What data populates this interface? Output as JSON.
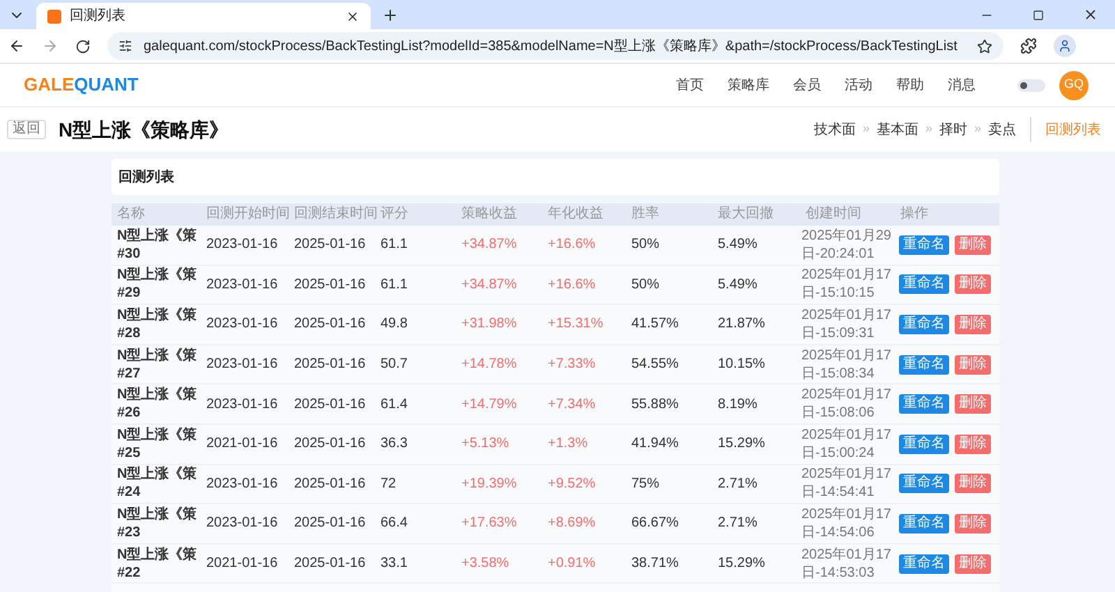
{
  "browser": {
    "tab_title": "回测列表",
    "url": "galequant.com/stockProcess/BackTestingList?modelId=385&modelName=N型上涨《策略库》&path=/stockProcess/BackTestingList"
  },
  "header": {
    "logo": [
      "GALE",
      "QUANT"
    ],
    "nav": [
      "首页",
      "策略库",
      "会员",
      "活动",
      "帮助",
      "消息"
    ],
    "theme_toggle_on": false,
    "avatar": "GQ"
  },
  "subheader": {
    "back": "返回",
    "separator": "»",
    "title": "N型上涨《策略库》",
    "steps": [
      {
        "label": "技术面",
        "selected": false
      },
      {
        "label": "基本面",
        "selected": false
      },
      {
        "label": "择时",
        "selected": false
      },
      {
        "label": "卖点",
        "selected": false
      }
    ],
    "current": {
      "label": "回测列表",
      "selected": true
    }
  },
  "card_title": "回测列表",
  "table": {
    "columns": [
      "名称",
      "回测开始时间",
      "回测结束时间",
      "评分",
      "策略收益",
      "年化收益",
      "胜率",
      "最大回撤",
      "创建时间",
      "操作"
    ],
    "rows": [
      {
        "name": "N型上涨《策",
        "number": "#30",
        "start": "2023-01-16",
        "end": "2025-01-16",
        "score": "61.1",
        "return": "+34.87%",
        "annual": "+16.6%",
        "win": "50%",
        "drawdown": "5.49%",
        "created": [
          "2025年01月29",
          "日-20:24:01"
        ],
        "rename": "重命名",
        "delete": "删除"
      },
      {
        "name": "N型上涨《策",
        "number": "#29",
        "start": "2023-01-16",
        "end": "2025-01-16",
        "score": "61.1",
        "return": "+34.87%",
        "annual": "+16.6%",
        "win": "50%",
        "drawdown": "5.49%",
        "created": [
          "2025年01月17",
          "日-15:10:15"
        ],
        "rename": "重命名",
        "delete": "删除"
      },
      {
        "name": "N型上涨《策",
        "number": "#28",
        "start": "2023-01-16",
        "end": "2025-01-16",
        "score": "49.8",
        "return": "+31.98%",
        "annual": "+15.31%",
        "win": "41.57%",
        "drawdown": "21.87%",
        "created": [
          "2025年01月17",
          "日-15:09:31"
        ],
        "rename": "重命名",
        "delete": "删除"
      },
      {
        "name": "N型上涨《策",
        "number": "#27",
        "start": "2023-01-16",
        "end": "2025-01-16",
        "score": "50.7",
        "return": "+14.78%",
        "annual": "+7.33%",
        "win": "54.55%",
        "drawdown": "10.15%",
        "created": [
          "2025年01月17",
          "日-15:08:34"
        ],
        "rename": "重命名",
        "delete": "删除"
      },
      {
        "name": "N型上涨《策",
        "number": "#26",
        "start": "2023-01-16",
        "end": "2025-01-16",
        "score": "61.4",
        "return": "+14.79%",
        "annual": "+7.34%",
        "win": "55.88%",
        "drawdown": "8.19%",
        "created": [
          "2025年01月17",
          "日-15:08:06"
        ],
        "rename": "重命名",
        "delete": "删除"
      },
      {
        "name": "N型上涨《策",
        "number": "#25",
        "start": "2021-01-16",
        "end": "2025-01-16",
        "score": "36.3",
        "return": "+5.13%",
        "annual": "+1.3%",
        "win": "41.94%",
        "drawdown": "15.29%",
        "created": [
          "2025年01月17",
          "日-15:00:24"
        ],
        "rename": "重命名",
        "delete": "删除"
      },
      {
        "name": "N型上涨《策",
        "number": "#24",
        "start": "2023-01-16",
        "end": "2025-01-16",
        "score": "72",
        "return": "+19.39%",
        "annual": "+9.52%",
        "win": "75%",
        "drawdown": "2.71%",
        "created": [
          "2025年01月17",
          "日-14:54:41"
        ],
        "rename": "重命名",
        "delete": "删除"
      },
      {
        "name": "N型上涨《策",
        "number": "#23",
        "start": "2023-01-16",
        "end": "2025-01-16",
        "score": "66.4",
        "return": "+17.63%",
        "annual": "+8.69%",
        "win": "66.67%",
        "drawdown": "2.71%",
        "created": [
          "2025年01月17",
          "日-14:54:06"
        ],
        "rename": "重命名",
        "delete": "删除"
      },
      {
        "name": "N型上涨《策",
        "number": "#22",
        "start": "2021-01-16",
        "end": "2025-01-16",
        "score": "33.1",
        "return": "+3.58%",
        "annual": "+0.91%",
        "win": "38.71%",
        "drawdown": "15.29%",
        "created": [
          "2025年01月17",
          "日-14:53:03"
        ],
        "rename": "重命名",
        "delete": "删除"
      }
    ]
  }
}
